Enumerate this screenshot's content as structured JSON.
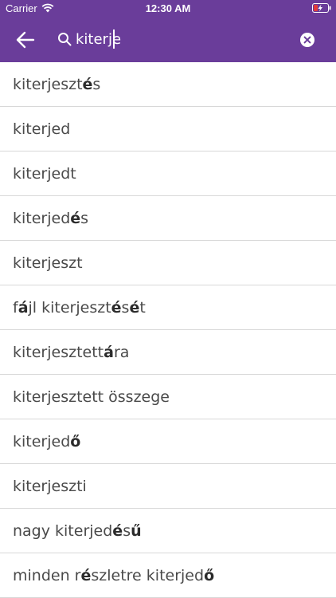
{
  "status_bar": {
    "carrier": "Carrier",
    "time": "12:30 AM"
  },
  "search": {
    "value": "kiterje",
    "placeholder": ""
  },
  "icons": {
    "back": "arrow-left-icon",
    "search": "search-icon",
    "clear": "clear-circle-icon"
  },
  "colors": {
    "header": "#6a3d9a",
    "text": "#4a4a4a",
    "divider": "#d8d8d8"
  },
  "results": [
    {
      "segments": [
        {
          "t": "kiterjeszt",
          "b": false
        },
        {
          "t": "é",
          "b": true
        },
        {
          "t": "s",
          "b": false
        }
      ]
    },
    {
      "segments": [
        {
          "t": "kiterjed",
          "b": false
        }
      ]
    },
    {
      "segments": [
        {
          "t": "kiterjedt",
          "b": false
        }
      ]
    },
    {
      "segments": [
        {
          "t": "kiterjed",
          "b": false
        },
        {
          "t": "é",
          "b": true
        },
        {
          "t": "s",
          "b": false
        }
      ]
    },
    {
      "segments": [
        {
          "t": "kiterjeszt",
          "b": false
        }
      ]
    },
    {
      "segments": [
        {
          "t": "f",
          "b": false
        },
        {
          "t": "á",
          "b": true
        },
        {
          "t": "jl kiterjeszt",
          "b": false
        },
        {
          "t": "é",
          "b": true
        },
        {
          "t": "s",
          "b": false
        },
        {
          "t": "é",
          "b": true
        },
        {
          "t": "t",
          "b": false
        }
      ]
    },
    {
      "segments": [
        {
          "t": "kiterjesztett ",
          "b": false
        },
        {
          "t": "á",
          "b": true
        },
        {
          "t": "ra",
          "b": false
        }
      ]
    },
    {
      "segments": [
        {
          "t": "kiterjesztett összege",
          "b": false
        }
      ]
    },
    {
      "segments": [
        {
          "t": "kiterjed",
          "b": false
        },
        {
          "t": "ő",
          "b": true
        }
      ]
    },
    {
      "segments": [
        {
          "t": "kiterjeszti",
          "b": false
        }
      ]
    },
    {
      "segments": [
        {
          "t": "nagy kiterjed",
          "b": false
        },
        {
          "t": "é",
          "b": true
        },
        {
          "t": "s",
          "b": false
        },
        {
          "t": "ű",
          "b": true
        }
      ]
    },
    {
      "segments": [
        {
          "t": "minden r",
          "b": false
        },
        {
          "t": "é",
          "b": true
        },
        {
          "t": "szletre kiterjed",
          "b": false
        },
        {
          "t": "ő",
          "b": true
        }
      ]
    }
  ]
}
